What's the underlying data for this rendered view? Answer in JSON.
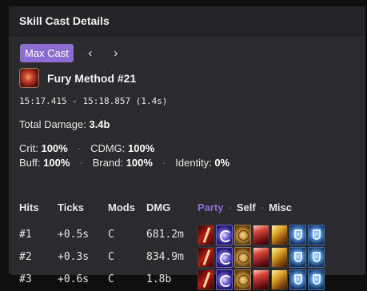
{
  "header": {
    "title": "Skill Cast Details"
  },
  "nav": {
    "max_cast_label": "Max Cast",
    "prev_label": "‹",
    "next_label": "›"
  },
  "skill": {
    "name": "Fury Method #21",
    "icon": "fury-method-icon"
  },
  "cast_time": "15:17.415 - 15:18.857 (1.4s)",
  "total": {
    "label": "Total Damage:",
    "value": "3.4b"
  },
  "stats": {
    "crit_label": "Crit:",
    "crit_value": "100%",
    "cdmg_label": "CDMG:",
    "cdmg_value": "100%",
    "buff_label": "Buff:",
    "buff_value": "100%",
    "brand_label": "Brand:",
    "brand_value": "100%",
    "identity_label": "Identity:",
    "identity_value": "0%",
    "separator": "·"
  },
  "table": {
    "headers": {
      "hits": "Hits",
      "ticks": "Ticks",
      "mods": "Mods",
      "dmg": "DMG"
    },
    "tabs": {
      "party": "Party",
      "self": "Self",
      "misc": "Misc",
      "active": "party",
      "separator": "·"
    },
    "buff_icons": [
      "sword-buff-icon",
      "swirl-buff-icon",
      "coin-buff-icon",
      "blood-buff-icon",
      "gold-buff-icon",
      "shield-buff-icon",
      "shield-buff-icon"
    ],
    "rows": [
      {
        "hit": "#1",
        "tick": "+0.5s",
        "mods": "C",
        "dmg": "681.2m"
      },
      {
        "hit": "#2",
        "tick": "+0.3s",
        "mods": "C",
        "dmg": "834.9m"
      },
      {
        "hit": "#3",
        "tick": "+0.6s",
        "mods": "C",
        "dmg": "1.8b"
      }
    ]
  },
  "colors": {
    "accent": "#8c6dd2",
    "panel": "#2b2b2d",
    "background": "#0f0f10"
  }
}
